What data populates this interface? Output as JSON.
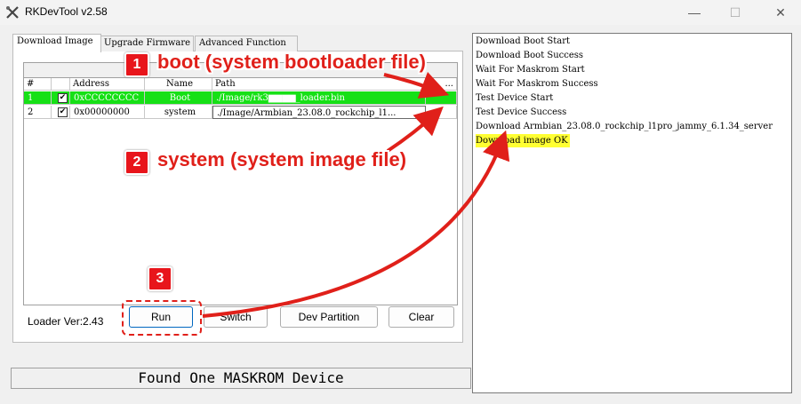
{
  "window": {
    "title": "RKDevTool v2.58",
    "minimize_glyph": "—",
    "maximize_glyph": "☐",
    "close_glyph": "✕"
  },
  "tabs": [
    {
      "label": "Download Image",
      "active": true
    },
    {
      "label": "Upgrade Firmware",
      "active": false
    },
    {
      "label": "Advanced Function",
      "active": false
    }
  ],
  "grid": {
    "columns": [
      "#",
      "",
      "Address",
      "Name",
      "Path",
      "..."
    ],
    "rows": [
      {
        "num": "1",
        "checked": "✔",
        "address": "0xCCCCCCCC",
        "name": "Boot",
        "path": "./Image/rk3▆▆▆▆_loader.bin",
        "selected": true
      },
      {
        "num": "2",
        "checked": "✔",
        "address": "0x00000000",
        "name": "system",
        "path": "./Image/Armbian_23.08.0_rockchip_l1...",
        "selected": false
      }
    ]
  },
  "loader_version": "Loader Ver:2.43",
  "buttons": {
    "run": "Run",
    "switch": "Switch",
    "dev_partition": "Dev Partition",
    "clear": "Clear"
  },
  "status": "Found One MASKROM Device",
  "log": [
    "Download Boot Start",
    "Download Boot Success",
    "Wait For Maskrom Start",
    "Wait For Maskrom Success",
    "Test Device Start",
    "Test Device Success",
    "Download Armbian_23.08.0_rockchip_l1pro_jammy_6.1.34_server",
    "Download image OK"
  ],
  "annotations": [
    {
      "number": "1",
      "text": "boot (system bootloader file)"
    },
    {
      "number": "2",
      "text": "system (system image file)"
    },
    {
      "number": "3",
      "text": ""
    }
  ],
  "colors": {
    "selected_row": "#16e016",
    "highlight": "#ffff33",
    "annotation_red": "#e0201a"
  }
}
